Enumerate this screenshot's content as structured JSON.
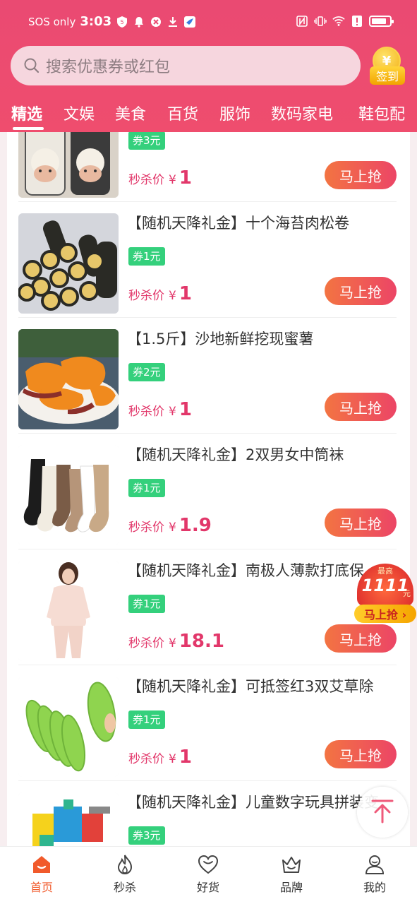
{
  "status_bar": {
    "carrier": "SOS only",
    "time": "3:03",
    "battery_level": 0.85
  },
  "search": {
    "placeholder": "搜索优惠券或红包",
    "signin_symbol": "¥",
    "signin_label": "签到"
  },
  "tabs": [
    "精选",
    "文娱",
    "美食",
    "百货",
    "服饰",
    "数码家电",
    "鞋包配"
  ],
  "active_tab": "精选",
  "price_label": "秒杀价",
  "currency": "¥",
  "buy_label": "马上抢",
  "products": [
    {
      "title": "",
      "coupon": "券3元",
      "price": "1"
    },
    {
      "title": "【随机天降礼金】十个海苔肉松卷",
      "coupon": "券1元",
      "price": "1"
    },
    {
      "title": "【1.5斤】沙地新鲜挖现蜜薯",
      "coupon": "券2元",
      "price": "1"
    },
    {
      "title": "【随机天降礼金】2双男女中筒袜",
      "coupon": "券1元",
      "price": "1.9"
    },
    {
      "title": "【随机天降礼金】南极人薄款打底保",
      "coupon": "券1元",
      "price": "18.1"
    },
    {
      "title": "【随机天降礼金】可抵签红3双艾草除",
      "coupon": "券1元",
      "price": "1"
    },
    {
      "title": "【随机天降礼金】儿童数字玩具拼装变",
      "coupon": "券3元",
      "price": ""
    }
  ],
  "promo": {
    "top_text": "最高",
    "amount": "1111",
    "unit": "元",
    "button": "马上抢 ›"
  },
  "bottom_nav": [
    {
      "label": "首页",
      "icon": "home-icon",
      "active": true
    },
    {
      "label": "秒杀",
      "icon": "flame-icon",
      "active": false
    },
    {
      "label": "好货",
      "icon": "heart-icon",
      "active": false
    },
    {
      "label": "品牌",
      "icon": "crown-icon",
      "active": false
    },
    {
      "label": "我的",
      "icon": "user-icon",
      "active": false
    }
  ],
  "colors": {
    "header": "#ea4a72",
    "accent_price": "#e2376a",
    "coupon": "#34d07c",
    "nav_active": "#f15a2b"
  }
}
